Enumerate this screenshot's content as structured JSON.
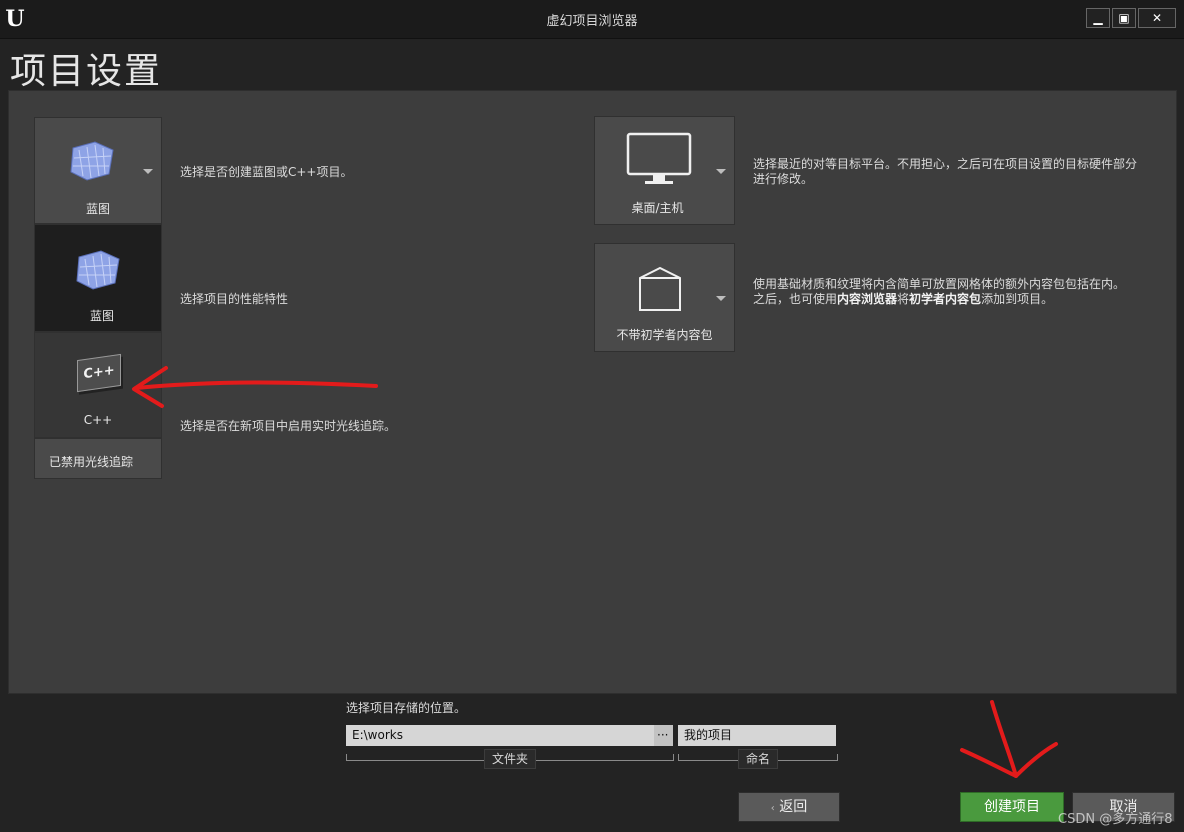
{
  "window": {
    "title": "虚幻项目浏览器",
    "logo": "U"
  },
  "page": {
    "heading": "项目设置"
  },
  "left": {
    "template_tile_label": "蓝图",
    "template_desc": "选择是否创建蓝图或C++项目。",
    "dropdown_blueprint_label": "蓝图",
    "dropdown_cpp_label": "C++",
    "cpp_icon_text": "C++",
    "performance_desc": "选择项目的性能特性",
    "raytracing_desc": "选择是否在新项目中启用实时光线追踪。",
    "raytracing_label": "已禁用光线追踪"
  },
  "right": {
    "platform_label": "桌面/主机",
    "platform_desc": "选择最近的对等目标平台。不用担心，之后可在项目设置的目标硬件部分进行修改。",
    "content_label": "不带初学者内容包",
    "content_desc_1": "使用基础材质和纹理将内含简单可放置网格体的额外内容包包括在内。",
    "content_desc_2": "之后，也可使用",
    "content_desc_bold_1": "内容浏览器",
    "content_desc_3": "将",
    "content_desc_bold_2": "初学者内容包",
    "content_desc_4": "添加到项目。"
  },
  "location": {
    "prompt": "选择项目存储的位置。",
    "folder_value": "E:\\works",
    "browse_label": "···",
    "folder_caption": "文件夹",
    "name_value": "我的项目",
    "name_caption": "命名"
  },
  "buttons": {
    "back": "返回",
    "create": "创建项目",
    "cancel": "取消"
  },
  "watermark": "CSDN @多方通行8",
  "colors": {
    "create_button": "#4a9a3e",
    "annotation": "#e31b1b"
  },
  "icons": [
    "unreal-logo-icon",
    "minimize-icon",
    "maximize-icon",
    "close-icon",
    "blueprint-icon",
    "cpp-icon",
    "monitor-icon",
    "box-icon",
    "dropdown-arrow-icon"
  ]
}
